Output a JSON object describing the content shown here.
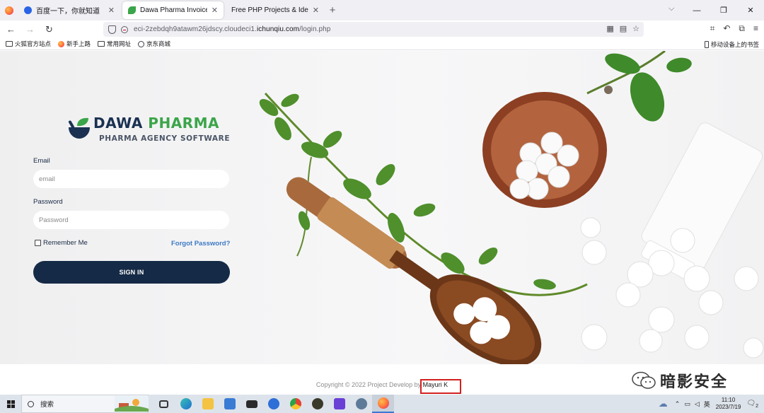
{
  "browser": {
    "tabs": [
      {
        "title": "百度一下，你就知道"
      },
      {
        "title": "Dawa Pharma Invoice System"
      },
      {
        "title": "Free PHP Projects & Ideas with Source Code"
      }
    ],
    "url_prefix": "eci-2zebdqh9atawm26jdscy.cloudeci1.",
    "url_domain": "ichunqiu.com",
    "url_path": "/login.php",
    "bookmarks": [
      "火狐官方站点",
      "新手上路",
      "常用网址",
      "京东商城"
    ],
    "mobile_bookmarks": "移动设备上的书签"
  },
  "login": {
    "brand_first": "DAWA",
    "brand_second": "PHARMA",
    "tagline": "PHARMA AGENCY SOFTWARE",
    "email_label": "Email",
    "email_placeholder": "email",
    "password_label": "Password",
    "password_placeholder": "Password",
    "remember_label": "Remember Me",
    "forgot_label": "Forgot Password?",
    "signin_label": "SIGN IN"
  },
  "footer": {
    "text": "Copyright © 2022 Project Develop by",
    "author": "Mayuri K"
  },
  "watermark": "暗影安全",
  "taskbar": {
    "search_label": "搜索",
    "ime": "英",
    "time": "11:10",
    "date": "2023/7/19",
    "notifications": "2"
  },
  "colors": {
    "brand_navy": "#152a46",
    "brand_green": "#3ba54a",
    "link_blue": "#3d79c4",
    "highlight_red": "#d32020"
  }
}
